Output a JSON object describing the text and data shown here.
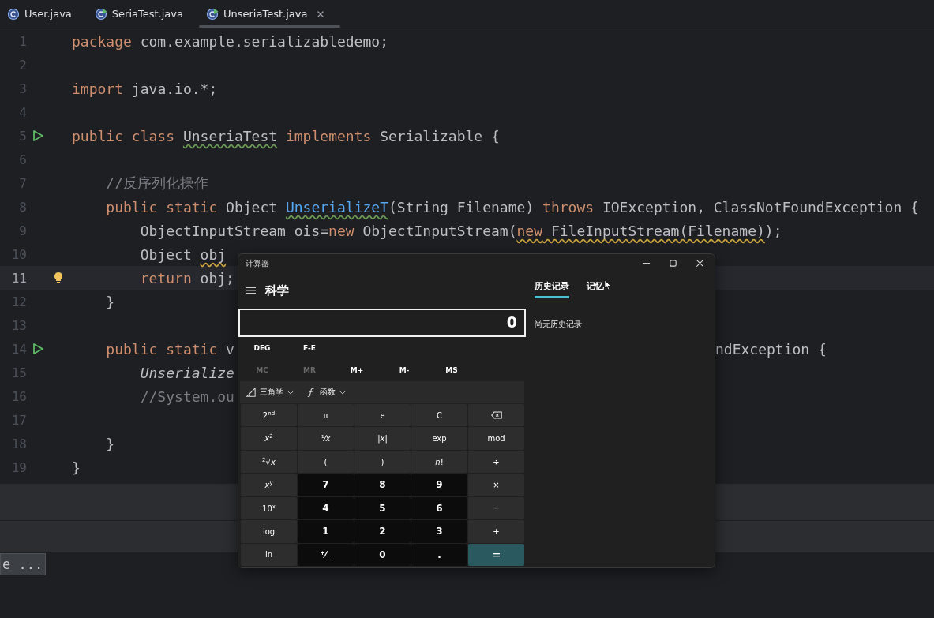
{
  "tabs": [
    {
      "label": "User.java",
      "kind": "class",
      "selected": false,
      "closable": false
    },
    {
      "label": "SeriaTest.java",
      "kind": "runnable",
      "selected": false,
      "closable": false
    },
    {
      "label": "UnseriaTest.java",
      "kind": "runnable",
      "selected": true,
      "closable": true
    }
  ],
  "editor": {
    "lines": [
      {
        "number": "1",
        "run": false,
        "bulb": false,
        "current": false,
        "parts": [
          [
            {
              "text": "package",
              "kind": "keyword"
            },
            {
              "text": " com.example.serializabledemo;",
              "kind": "plain"
            }
          ]
        ]
      },
      {
        "number": "2",
        "run": false,
        "bulb": false,
        "current": false
      },
      {
        "number": "3",
        "run": false,
        "bulb": false,
        "current": false,
        "parts": [
          [
            {
              "text": "import",
              "kind": "keyword"
            },
            {
              "text": " java.io.*;",
              "kind": "plain"
            }
          ]
        ]
      },
      {
        "number": "4",
        "run": false,
        "bulb": false,
        "current": false
      },
      {
        "number": "5",
        "run": true,
        "bulb": false,
        "current": false,
        "parts": [
          [
            {
              "text": "public class ",
              "kind": "keyword"
            },
            {
              "text": "UnseriaTest",
              "kind": "plain",
              "typo": true
            },
            {
              "text": " implements",
              "kind": "keyword"
            },
            {
              "text": " Serializable {",
              "kind": "plain"
            }
          ]
        ]
      },
      {
        "number": "6",
        "run": false,
        "bulb": false,
        "current": false
      },
      {
        "number": "7",
        "run": false,
        "bulb": false,
        "current": false,
        "parts": [
          [
            {
              "text": "    //反序列化操作",
              "kind": "comment"
            }
          ]
        ]
      },
      {
        "number": "8",
        "run": false,
        "bulb": false,
        "current": false,
        "parts": [
          [
            {
              "text": "    public static",
              "kind": "keyword"
            },
            {
              "text": " Object ",
              "kind": "plain"
            },
            {
              "text": "UnserializeT",
              "kind": "declaration",
              "typo": true
            },
            {
              "text": "(String Filename) ",
              "kind": "plain"
            },
            {
              "text": "throws",
              "kind": "keyword"
            },
            {
              "text": " IOException, ClassNotFoundException {",
              "kind": "plain"
            }
          ]
        ]
      },
      {
        "number": "9",
        "run": false,
        "bulb": false,
        "current": false,
        "parts": [
          [
            {
              "text": "        ObjectInputStream ois=",
              "kind": "plain"
            },
            {
              "text": "new",
              "kind": "keyword"
            },
            {
              "text": " ObjectInputStream(",
              "kind": "plain"
            },
            {
              "text": "new",
              "kind": "keyword",
              "warning": true
            },
            {
              "text": " FileInputStream(Filename)",
              "kind": "plain",
              "warning": true
            },
            {
              "text": ");",
              "kind": "plain"
            }
          ]
        ]
      },
      {
        "number": "10",
        "run": false,
        "bulb": false,
        "current": false,
        "parts": [
          [
            {
              "text": "        Object ",
              "kind": "plain"
            },
            {
              "text": "obj",
              "kind": "plain",
              "warning": true
            }
          ]
        ]
      },
      {
        "number": "11",
        "run": false,
        "bulb": true,
        "current": true,
        "parts": [
          [
            {
              "text": "        return",
              "kind": "keyword"
            },
            {
              "text": " obj;",
              "kind": "plain"
            }
          ]
        ]
      },
      {
        "number": "12",
        "run": false,
        "bulb": false,
        "current": false,
        "parts": [
          [
            {
              "text": "    }",
              "kind": "plain"
            }
          ]
        ]
      },
      {
        "number": "13",
        "run": false,
        "bulb": false,
        "current": false
      },
      {
        "number": "14",
        "run": true,
        "bulb": false,
        "current": false,
        "parts": [
          [
            {
              "text": "    public static",
              "kind": "keyword"
            },
            {
              "text": " v",
              "kind": "plain"
            }
          ],
          [
            {
              "text": "ndException {",
              "kind": "plain"
            }
          ]
        ]
      },
      {
        "number": "15",
        "run": false,
        "bulb": false,
        "current": false,
        "parts": [
          [
            {
              "text": "        Unserialize",
              "kind": "italic"
            }
          ]
        ]
      },
      {
        "number": "16",
        "run": false,
        "bulb": false,
        "current": false,
        "parts": [
          [
            {
              "text": "        //System.ou",
              "kind": "comment"
            }
          ]
        ]
      },
      {
        "number": "17",
        "run": false,
        "bulb": false,
        "current": false
      },
      {
        "number": "18",
        "run": false,
        "bulb": false,
        "current": false,
        "parts": [
          [
            {
              "text": "    }",
              "kind": "plain"
            }
          ]
        ]
      },
      {
        "number": "19",
        "run": false,
        "bulb": false,
        "current": false,
        "parts": [
          [
            {
              "text": "}",
              "kind": "plain"
            }
          ]
        ]
      }
    ]
  },
  "tooltip": {
    "text": "e ..."
  },
  "calculator": {
    "title": "计算器",
    "mode": "科学",
    "history_tabs": [
      {
        "label": "历史记录",
        "selected": true
      },
      {
        "label": "记忆",
        "selected": false
      }
    ],
    "history_message": "尚无历史记录",
    "display": "0",
    "angle_buttons": [
      "DEG",
      "F-E"
    ],
    "memory_buttons": [
      {
        "label": "MC",
        "disabled": true
      },
      {
        "label": "MR",
        "disabled": true
      },
      {
        "label": "M+",
        "disabled": false
      },
      {
        "label": "M-",
        "disabled": false
      },
      {
        "label": "MS",
        "disabled": false
      }
    ],
    "menus": [
      "三角学",
      "函数"
    ],
    "keys": [
      {
        "label": "2$^{nd}$",
        "kind": "function"
      },
      {
        "label": "π",
        "kind": "function"
      },
      {
        "label": "e",
        "kind": "function"
      },
      {
        "label": "C",
        "kind": "function"
      },
      {
        "kind": "backspace"
      },
      {
        "label": "*x*$^{2}$",
        "kind": "function"
      },
      {
        "label": "¹⁄*x*",
        "kind": "function"
      },
      {
        "label": "|*x*|",
        "kind": "function"
      },
      {
        "label": "exp",
        "kind": "function"
      },
      {
        "label": "mod",
        "kind": "function"
      },
      {
        "label": "$^{2}$√*x*",
        "kind": "function"
      },
      {
        "label": "(",
        "kind": "function"
      },
      {
        "label": ")",
        "kind": "function"
      },
      {
        "label": "*n*!",
        "kind": "function"
      },
      {
        "label": "÷",
        "kind": "function"
      },
      {
        "label": "*x*$^{y}$",
        "kind": "function"
      },
      {
        "label": "7",
        "kind": "digit"
      },
      {
        "label": "8",
        "kind": "digit"
      },
      {
        "label": "9",
        "kind": "digit"
      },
      {
        "label": "×",
        "kind": "function"
      },
      {
        "label": "10$^{x}$",
        "kind": "function"
      },
      {
        "label": "4",
        "kind": "digit"
      },
      {
        "label": "5",
        "kind": "digit"
      },
      {
        "label": "6",
        "kind": "digit"
      },
      {
        "label": "−",
        "kind": "function"
      },
      {
        "label": "log",
        "kind": "function"
      },
      {
        "label": "1",
        "kind": "digit"
      },
      {
        "label": "2",
        "kind": "digit"
      },
      {
        "label": "3",
        "kind": "digit"
      },
      {
        "label": "+",
        "kind": "function"
      },
      {
        "label": "ln",
        "kind": "function"
      },
      {
        "label": "⁺⁄₋",
        "kind": "digit"
      },
      {
        "label": "0",
        "kind": "digit"
      },
      {
        "label": ".",
        "kind": "digit"
      },
      {
        "label": "=",
        "kind": "equals"
      }
    ]
  }
}
